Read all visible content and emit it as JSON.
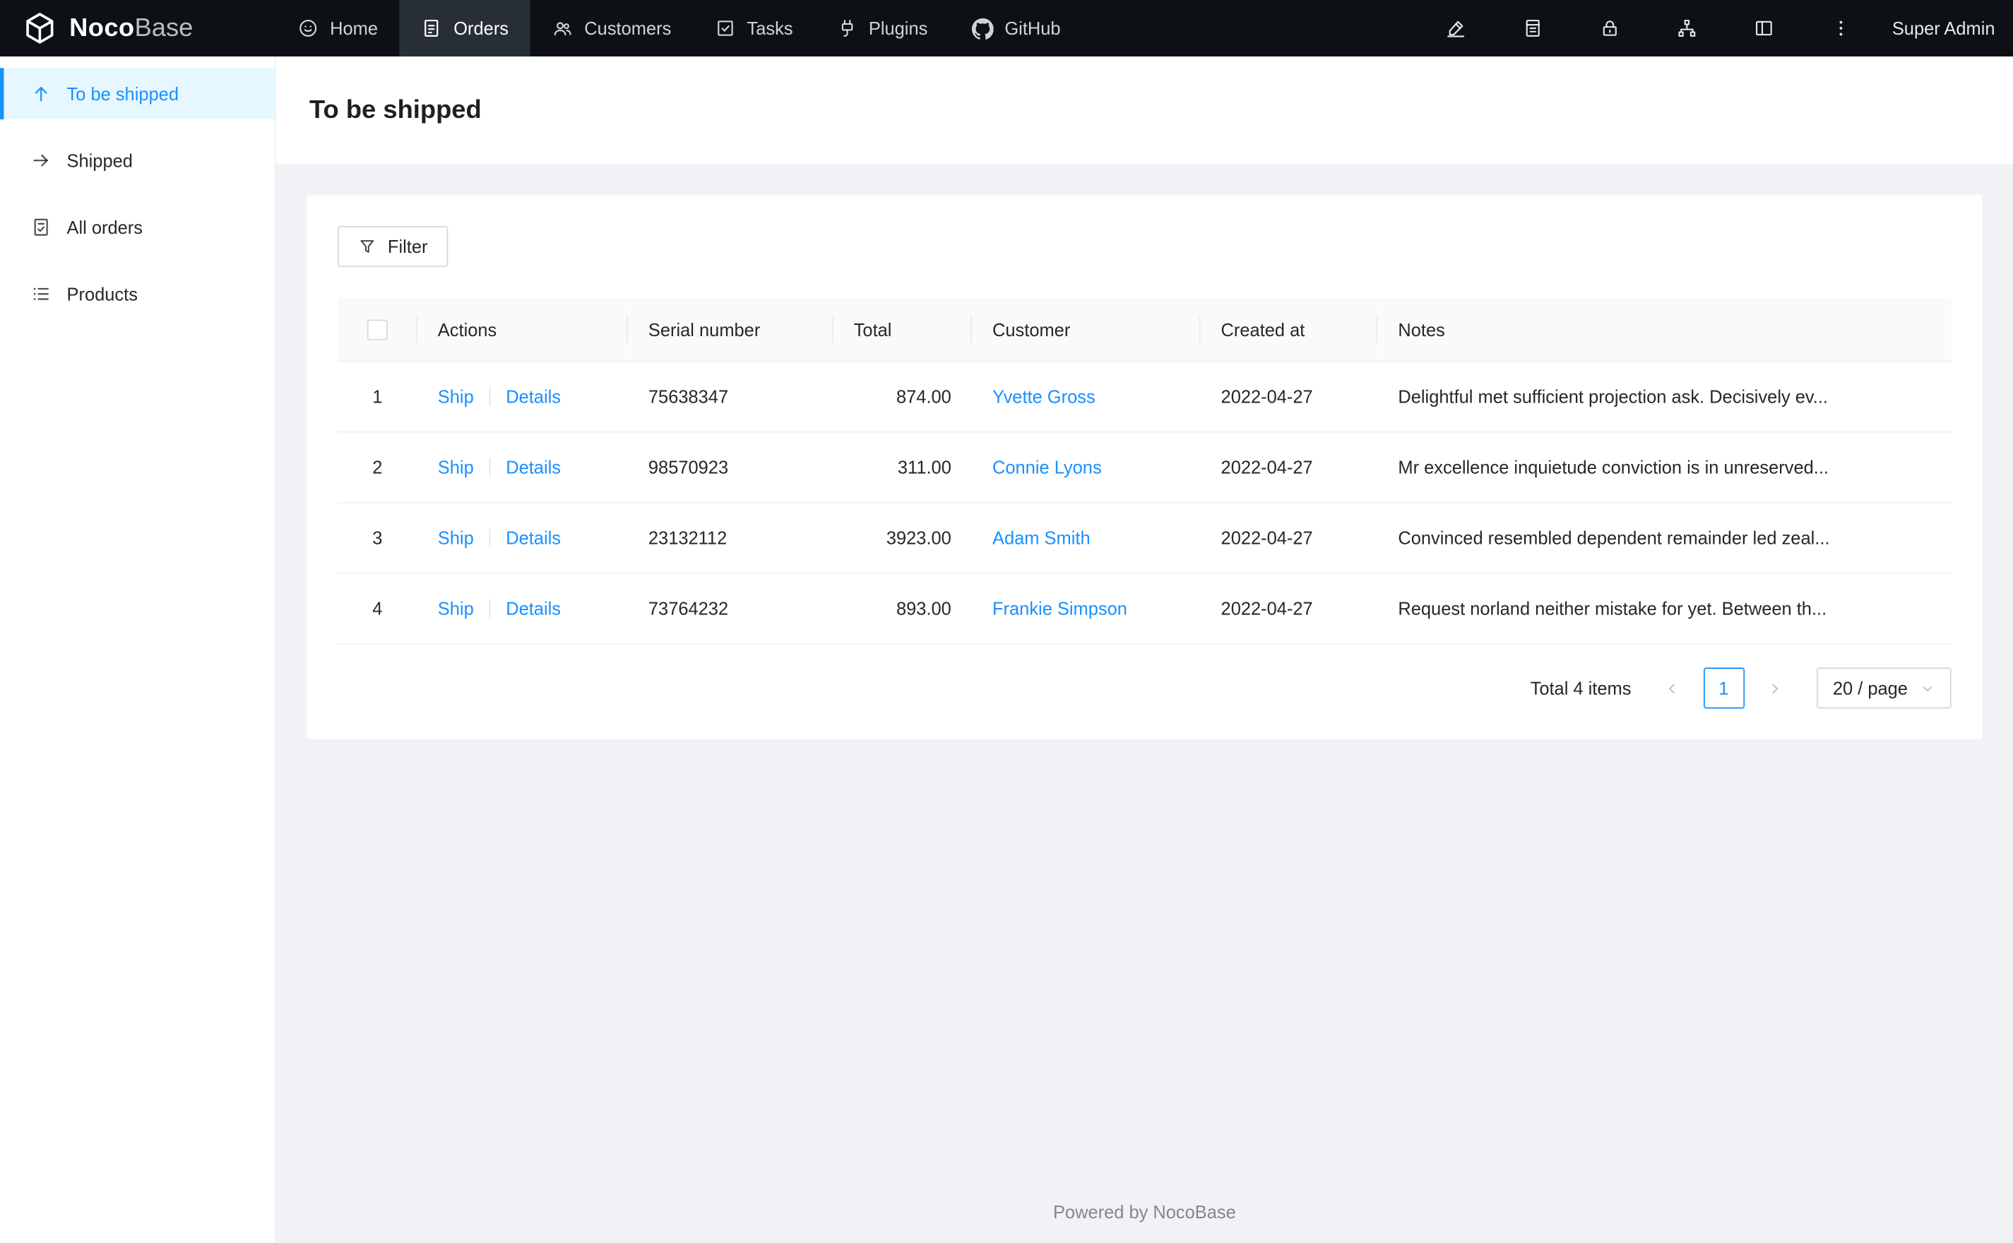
{
  "navbar": {
    "logo_text": "Noco",
    "logo_text_secondary": "Base",
    "items": [
      {
        "label": "Home",
        "icon": "smiley-icon"
      },
      {
        "label": "Orders",
        "icon": "orders-file-icon",
        "active": true
      },
      {
        "label": "Customers",
        "icon": "team-icon"
      },
      {
        "label": "Tasks",
        "icon": "check-square-icon"
      },
      {
        "label": "Plugins",
        "icon": "plug-icon"
      },
      {
        "label": "GitHub",
        "icon": "github-icon"
      }
    ],
    "right_icons": [
      "highlighter-icon",
      "book-icon",
      "lock-icon",
      "apartment-icon",
      "layout-icon",
      "more-vertical-icon"
    ],
    "user_label": "Super Admin"
  },
  "sidebar": {
    "items": [
      {
        "label": "To be shipped",
        "icon": "arrow-up-icon",
        "active": true
      },
      {
        "label": "Shipped",
        "icon": "arrow-right-icon",
        "active": false
      },
      {
        "label": "All orders",
        "icon": "file-done-icon",
        "active": false
      },
      {
        "label": "Products",
        "icon": "list-icon",
        "active": false
      }
    ]
  },
  "page": {
    "title": "To be shipped"
  },
  "toolbar": {
    "filter_label": "Filter"
  },
  "table": {
    "columns": {
      "actions": "Actions",
      "serial": "Serial number",
      "total": "Total",
      "customer": "Customer",
      "created_at": "Created at",
      "notes": "Notes"
    },
    "action_labels": {
      "ship": "Ship",
      "details": "Details"
    },
    "rows": [
      {
        "index": "1",
        "serial": "75638347",
        "total": "874.00",
        "customer": "Yvette Gross",
        "created_at": "2022-04-27",
        "notes": "Delightful met sufficient projection ask. Decisively ev..."
      },
      {
        "index": "2",
        "serial": "98570923",
        "total": "311.00",
        "customer": "Connie Lyons",
        "created_at": "2022-04-27",
        "notes": "Mr excellence inquietude conviction is in unreserved..."
      },
      {
        "index": "3",
        "serial": "23132112",
        "total": "3923.00",
        "customer": "Adam Smith",
        "created_at": "2022-04-27",
        "notes": "Convinced resembled dependent remainder led zeal..."
      },
      {
        "index": "4",
        "serial": "73764232",
        "total": "893.00",
        "customer": "Frankie Simpson",
        "created_at": "2022-04-27",
        "notes": "Request norland neither mistake for yet. Between th..."
      }
    ]
  },
  "pagination": {
    "total_label": "Total 4 items",
    "current_page": "1",
    "page_size_label": "20 / page"
  },
  "footer": {
    "text": "Powered by NocoBase"
  },
  "colors": {
    "accent": "#1890ff",
    "navbar_bg": "#0d1015",
    "navbar_active_bg": "#272e37",
    "sidebar_active_bg": "#e6f7ff",
    "page_bg": "#f0f2f5",
    "border": "#f0f0f0"
  }
}
